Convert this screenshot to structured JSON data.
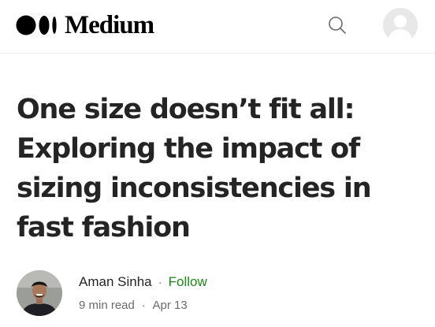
{
  "header": {
    "logo_text": "Medium",
    "search_icon": "search-icon",
    "avatar_icon": "default-user-avatar-icon"
  },
  "article": {
    "title": "One size doesn’t fit all: Exploring the impact of sizing inconsistencies in fast fashion",
    "author_name": "Aman Sinha",
    "separator": "·",
    "follow_label": "Follow",
    "read_time": "9 min read",
    "date": "Apr 13"
  },
  "colors": {
    "text": "#242424",
    "muted": "#6b6b6b",
    "follow_green": "#1a8917"
  }
}
